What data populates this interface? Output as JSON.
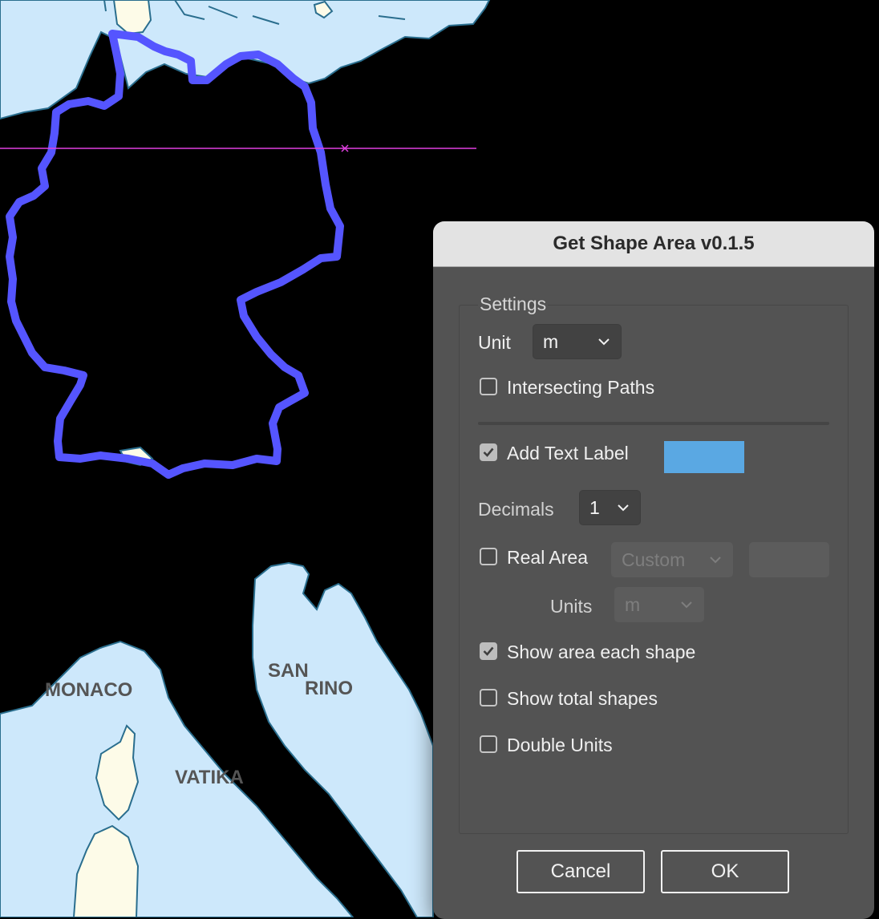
{
  "map": {
    "labels": [
      "MONACO",
      "SAN",
      "RINO",
      "VATIKA"
    ]
  },
  "dialog": {
    "title": "Get Shape Area v0.1.5",
    "settings_legend": "Settings",
    "unit": {
      "label": "Unit",
      "value": "m"
    },
    "intersecting_paths": {
      "label": "Intersecting Paths",
      "checked": false
    },
    "add_text_label": {
      "label": "Add Text Label",
      "checked": true,
      "color": "#5aa8e3"
    },
    "decimals": {
      "label": "Decimals",
      "value": "1"
    },
    "real_area": {
      "label": "Real Area",
      "checked": false,
      "preset": "Custom",
      "value": ""
    },
    "units": {
      "label": "Units",
      "value": "m"
    },
    "show_area_each_shape": {
      "label": "Show area each shape",
      "checked": true
    },
    "show_total_shapes": {
      "label": "Show total shapes",
      "checked": false
    },
    "double_units": {
      "label": "Double Units",
      "checked": false
    },
    "cancel_label": "Cancel",
    "ok_label": "OK"
  },
  "colors": {
    "sea": "#cde8fb",
    "land": "#000000",
    "island": "#fdfbe8",
    "coast": "#2a6e8e",
    "selection": "#5555ff",
    "guide": "#e040e0"
  }
}
